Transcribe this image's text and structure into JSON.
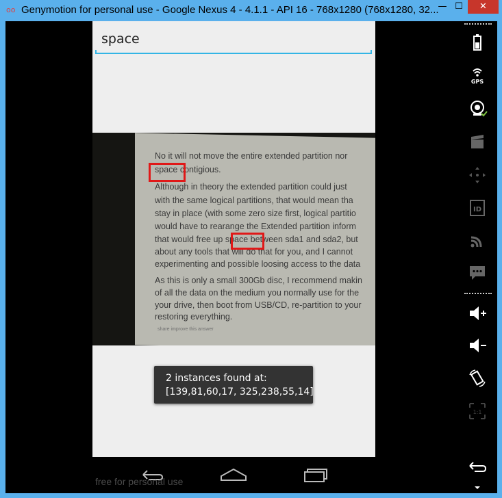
{
  "window": {
    "title": "Genymotion for personal use - Google Nexus 4 - 4.1.1 - API 16 - 768x1280 (768x1280, 32...",
    "app_icon": "oo",
    "controls": {
      "minimize": "—",
      "maximize": "☐",
      "close": "✕"
    }
  },
  "search": {
    "value": "space"
  },
  "photo": {
    "lines": [
      "No it will not move the entire extended partition nor",
      "space contigious.",
      "Although in theory the extended partition could just",
      "with the same logical partitions, that would mean tha",
      "stay in place (with some zero size first, logical partitio",
      "would have to rearange the Extended partition inform",
      "that would free up space between sda1 and sda2, but",
      "about any tools that will do that for you, and I cannot",
      "experimenting and possible loosing access to the data",
      "As this is only a small 300Gb disc, I recommend makin",
      "of all the data on the medium you normally use for the",
      "your drive, then boot from USB/CD, re-partition to your",
      "restoring everything."
    ],
    "footer_text": "share improve this answer"
  },
  "toast": {
    "line1": "2 instances found at:",
    "line2": "[139,81,60,17, 325,238,55,14]"
  },
  "watermark": "free for personal use",
  "sidebar": {
    "gps_label": "GPS",
    "id_label": "ID",
    "scale_label": "1:1"
  },
  "colors": {
    "accent": "#33b5e5",
    "highlight": "#e01818",
    "title_bar": "#5ab0ec"
  }
}
